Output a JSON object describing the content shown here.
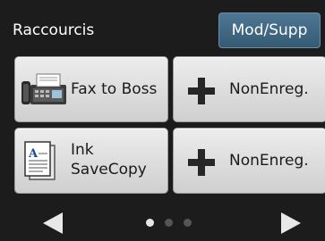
{
  "header": {
    "title": "Raccourcis",
    "mod_button_label": "Mod/Supp"
  },
  "shortcuts": [
    {
      "label": "Fax to Boss",
      "icon": "fax-icon"
    },
    {
      "label": "NonEnreg.",
      "icon": "plus-icon"
    },
    {
      "label_lines": [
        "Ink",
        "SaveCopy"
      ],
      "icon": "document-icon"
    },
    {
      "label": "NonEnreg.",
      "icon": "plus-icon"
    }
  ],
  "pagination": {
    "pages": 3,
    "current": 1
  },
  "colors": {
    "background": "#1c1c1c",
    "header_button": "#45708e",
    "tile": "#e0e0e0"
  }
}
